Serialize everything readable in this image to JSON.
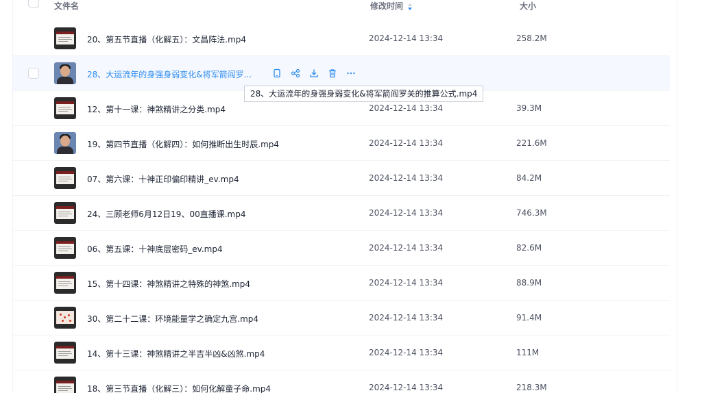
{
  "header": {
    "name_label": "文件名",
    "time_label": "修改时间",
    "size_label": "大小"
  },
  "files": [
    {
      "name": "20、第五节直播（化解五）：文昌阵法.mp4",
      "time": "2024-12-14 13:34",
      "size": "258.2M",
      "thumb": "doc"
    },
    {
      "name": "28、大运流年的身强身弱变化&将军箭阎罗...",
      "time": "",
      "size": "",
      "thumb": "photo",
      "hovered": true
    },
    {
      "name": "12、第十一课：神煞精讲之分类.mp4",
      "time": "2024-12-14 13:34",
      "size": "39.3M",
      "thumb": "doc"
    },
    {
      "name": "19、第四节直播（化解四）：如何推断出生时辰.mp4",
      "time": "2024-12-14 13:34",
      "size": "221.6M",
      "thumb": "photo"
    },
    {
      "name": "07、第六课：十神正印偏印精讲_ev.mp4",
      "time": "2024-12-14 13:34",
      "size": "84.2M",
      "thumb": "doc"
    },
    {
      "name": "24、三顾老师6月12日19、00直播课.mp4",
      "time": "2024-12-14 13:34",
      "size": "746.3M",
      "thumb": "doc"
    },
    {
      "name": "06、第五课：十神底层密码_ev.mp4",
      "time": "2024-12-14 13:34",
      "size": "82.6M",
      "thumb": "doc"
    },
    {
      "name": "15、第十四课：神煞精讲之特殊的神煞.mp4",
      "time": "2024-12-14 13:34",
      "size": "88.9M",
      "thumb": "doc"
    },
    {
      "name": "30、第二十二课：环境能量学之确定九宫.mp4",
      "time": "2024-12-14 13:34",
      "size": "91.4M",
      "thumb": "red"
    },
    {
      "name": "14、第十三课：神煞精讲之半吉半凶&凶煞.mp4",
      "time": "2024-12-14 13:34",
      "size": "111M",
      "thumb": "doc"
    },
    {
      "name": "18、第三节直播（化解三）：如何化解童子命.mp4",
      "time": "2024-12-14 13:34",
      "size": "218.3M",
      "thumb": "doc"
    }
  ],
  "tooltip": "28、大运流年的身强身弱变化&将军箭阎罗关的推算公式.mp4",
  "row_actions": [
    "phone-icon",
    "share-icon",
    "download-icon",
    "delete-icon",
    "more-icon"
  ],
  "colors": {
    "accent": "#2e8cf0",
    "hover_bg": "#f5f8ff"
  }
}
